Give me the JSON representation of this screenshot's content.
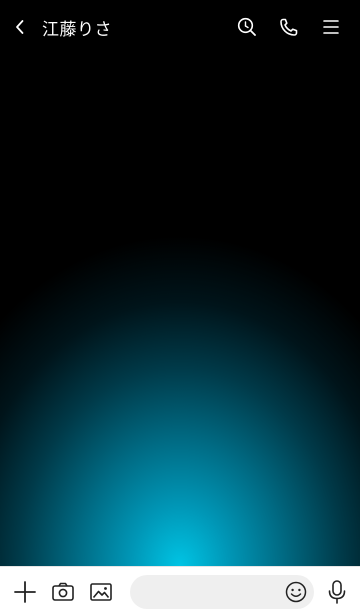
{
  "header": {
    "title": "江藤りさ",
    "back_icon": "chevron-left-icon",
    "actions": [
      "search-icon",
      "phone-icon",
      "menu-icon"
    ]
  },
  "footer": {
    "buttons": [
      "plus-icon",
      "camera-icon",
      "image-icon"
    ],
    "input_placeholder": "",
    "emoji_icon": "smiley-icon",
    "mic_icon": "microphone-icon"
  },
  "theme": {
    "background": "#000000",
    "glow": "#00c4e4",
    "footer_bg": "#ffffff",
    "input_bg": "#efefef"
  }
}
